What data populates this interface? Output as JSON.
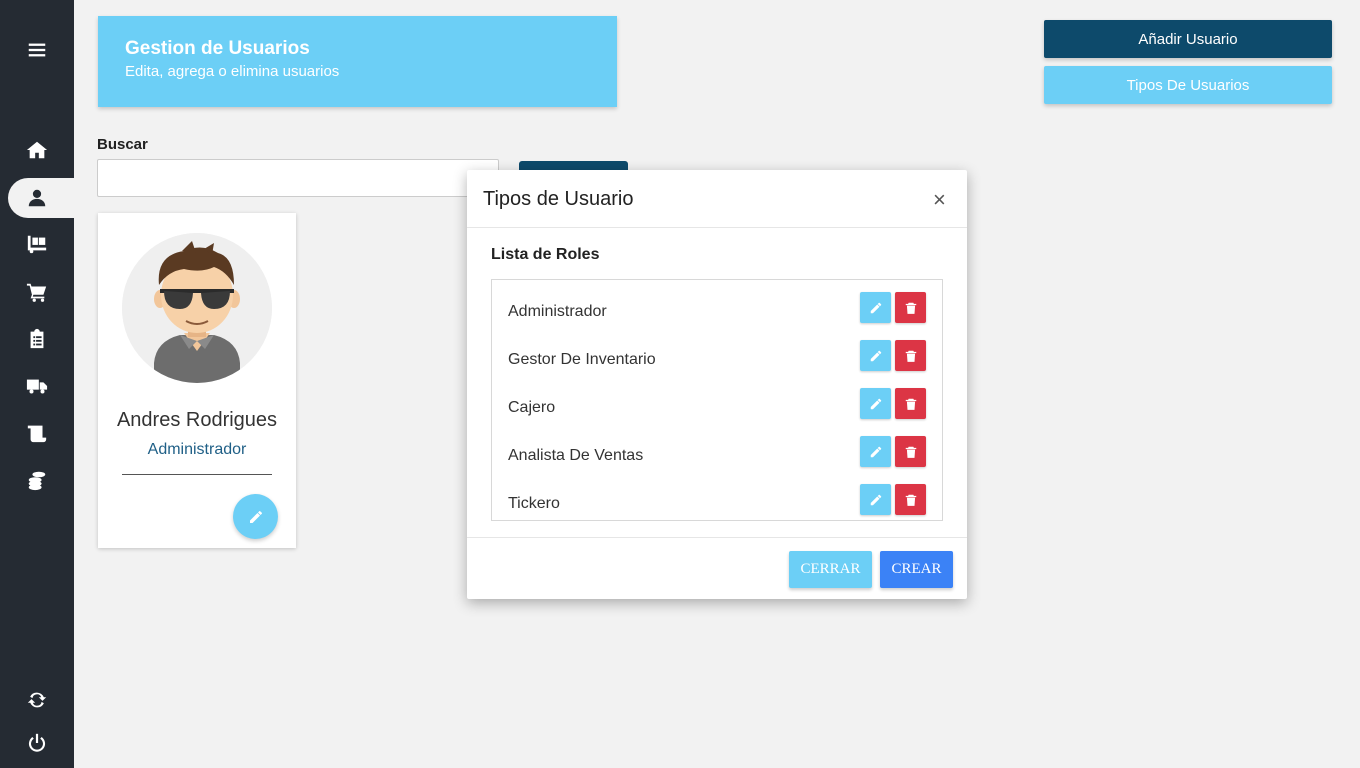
{
  "header": {
    "title": "Gestion de Usuarios",
    "subtitle": "Edita, agrega o elimina usuarios"
  },
  "actions": {
    "add_user": "Añadir Usuario",
    "user_types": "Tipos De Usuarios"
  },
  "search": {
    "label": "Buscar",
    "value": "",
    "placeholder": ""
  },
  "user_card": {
    "name": "Andres Rodrigues",
    "role": "Administrador"
  },
  "modal": {
    "title": "Tipos de Usuario",
    "close": "×",
    "list_title": "Lista de Roles",
    "roles": [
      {
        "name": "Administrador"
      },
      {
        "name": "Gestor De Inventario"
      },
      {
        "name": "Cajero"
      },
      {
        "name": "Analista De Ventas"
      },
      {
        "name": "Tickero"
      }
    ],
    "cancel_label": "CERRAR",
    "create_label": "CREAR"
  },
  "sidebar": {
    "items": [
      {
        "icon": "menu-icon"
      },
      {
        "icon": "home-icon"
      },
      {
        "icon": "user-icon",
        "active": true
      },
      {
        "icon": "dolly-icon"
      },
      {
        "icon": "cart-icon"
      },
      {
        "icon": "clipboard-icon"
      },
      {
        "icon": "truck-icon"
      },
      {
        "icon": "scroll-icon"
      },
      {
        "icon": "coins-icon"
      },
      {
        "icon": "sync-icon"
      },
      {
        "icon": "power-icon"
      }
    ]
  },
  "colors": {
    "sidebar": "#252b33",
    "primary_dark": "#0d4a6b",
    "accent": "#6ccff6",
    "danger": "#dc3545",
    "create": "#3b82f6"
  }
}
